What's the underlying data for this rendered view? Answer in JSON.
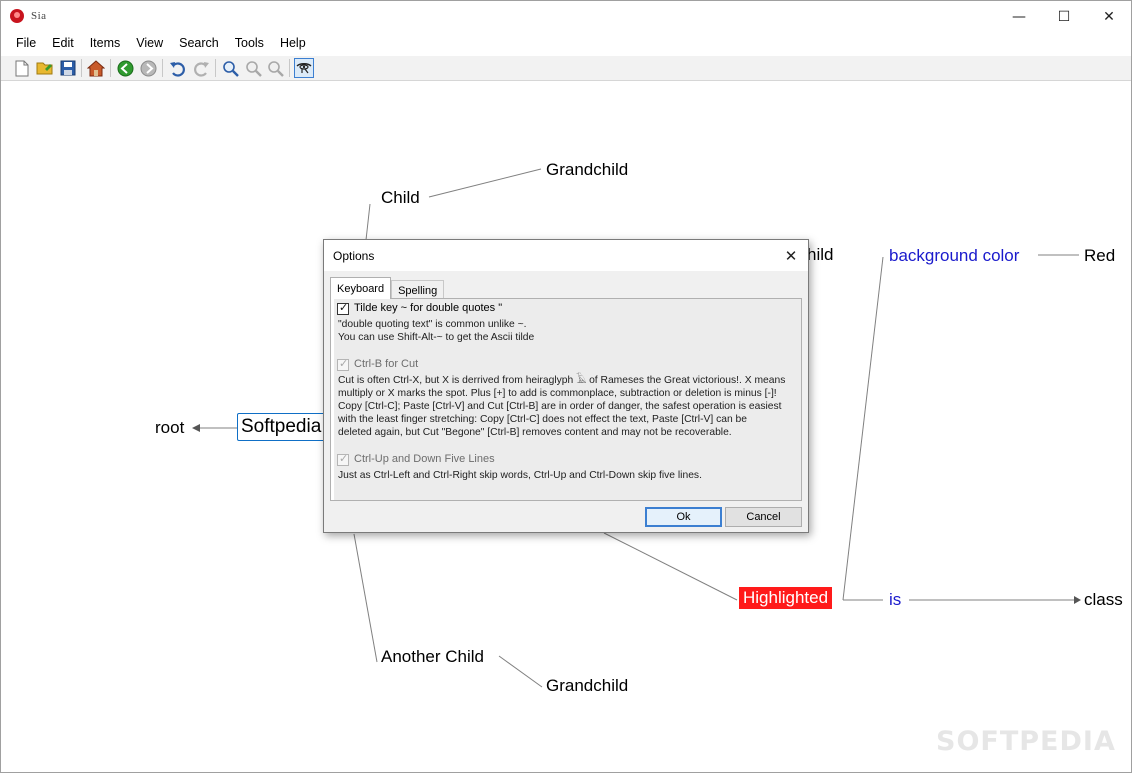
{
  "window": {
    "title": "Sia",
    "controls": {
      "minimize": "—",
      "maximize": "☐",
      "close": "✕"
    }
  },
  "menu": [
    "File",
    "Edit",
    "Items",
    "View",
    "Search",
    "Tools",
    "Help"
  ],
  "toolbar": {
    "icons": [
      "new-file-icon",
      "open-folder-icon",
      "save-icon",
      "home-icon",
      "back-icon",
      "forward-icon",
      "undo-icon",
      "redo-icon",
      "zoom-in-icon",
      "zoom-out-icon",
      "zoom-reset-icon",
      "eye-of-horus-icon"
    ]
  },
  "mindmap": {
    "root_label": "root",
    "center": "Softpedia",
    "nodes": {
      "child": "Child",
      "grandchild_top": "Grandchild",
      "partial_child": "hild",
      "another_child": "Another Child",
      "grandchild_bottom": "Grandchild",
      "highlighted": "Highlighted",
      "background_color": "background color",
      "red": "Red",
      "is": "is",
      "class": "class"
    },
    "colors": {
      "highlight": "#ff1a1a",
      "blue_text": "#1a1acc",
      "selection": "#0f6fc6"
    }
  },
  "dialog": {
    "title": "Options",
    "close": "✕",
    "tabs": [
      "Keyboard",
      "Spelling"
    ],
    "options": [
      {
        "label": "Tilde key ~ for double quotes \"",
        "checked": true,
        "enabled": true,
        "description": [
          "\"double quoting text\" is common unlike ~.",
          "You can use Shift-Alt-~ to get the Ascii tilde"
        ]
      },
      {
        "label": "Ctrl-B for Cut",
        "checked": true,
        "enabled": false,
        "description": [
          "Cut is often Ctrl-X, but X is derrived from heiraglyph 𓄿 of Rameses the Great victorious!. X means",
          "multiply or X marks the spot. Plus [+] to add is commonplace, subtraction or deletion is minus [-]!",
          "Copy [Ctrl-C]; Paste [Ctrl-V] and Cut [Ctrl-B] are in order of danger, the safest operation is easiest",
          "with the least finger stretching: Copy [Ctrl-C] does not effect the text, Paste [Ctrl-V] can be",
          "deleted again, but Cut \"Begone\" [Ctrl-B] removes content and may not be recoverable."
        ]
      },
      {
        "label": "Ctrl-Up and Down Five Lines",
        "checked": true,
        "enabled": false,
        "description": [
          "Just as Ctrl-Left and Ctrl-Right skip words, Ctrl-Up and Ctrl-Down skip five lines."
        ]
      }
    ],
    "buttons": {
      "ok": "Ok",
      "cancel": "Cancel"
    }
  },
  "watermark": "SOFTPEDIA"
}
